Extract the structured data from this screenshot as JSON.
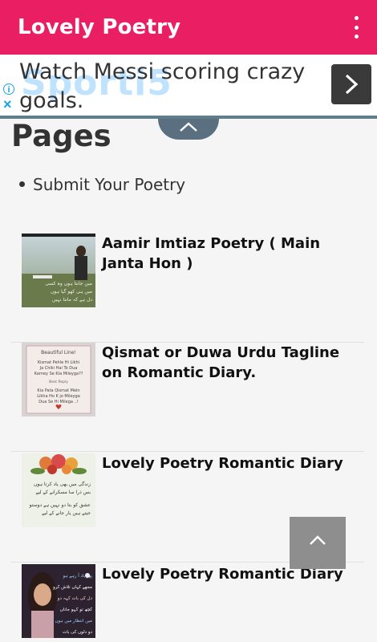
{
  "app": {
    "title": "Lovely Poetry"
  },
  "ad": {
    "brand": "Sporti5",
    "text": "Watch Messi scoring crazy goals.",
    "info": "i",
    "close": "×"
  },
  "pages": {
    "heading": "Pages",
    "links": [
      "Submit Your Poetry"
    ]
  },
  "posts": [
    {
      "title": "Aamir Imtiaz Poetry ( Main Janta Hon )"
    },
    {
      "title": "Qismat or Duwa Urdu Tagline on Romantic Diary.",
      "thumb_text": [
        "Beautiful Line!",
        "Kismat Pehle Hi Likhi",
        "Ja Chiki Hai To Dua",
        "Karney Se Kia Mileyga??",
        "Best Reply",
        "Kia Pata Qismat Mein",
        "Likha Ho K jo Mileyga",
        "Dua Se Hi Milega ..!"
      ]
    },
    {
      "title": "Lovely Poetry Romantic Diary"
    },
    {
      "title": "Lovely Poetry Romantic Diary"
    }
  ],
  "colors": {
    "appbar": "#e91e63",
    "ad_border": "#607d8b",
    "scroll_button": "#8e8e8e"
  }
}
